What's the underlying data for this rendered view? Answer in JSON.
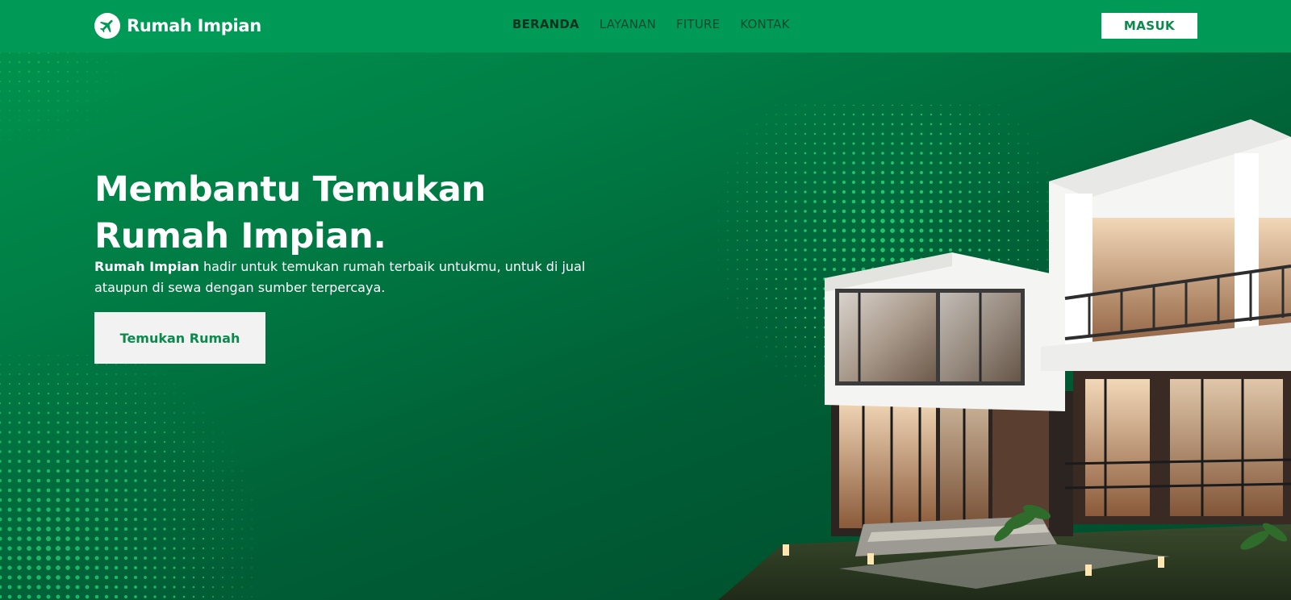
{
  "colors": {
    "brand_green": "#009a57",
    "hero_dark": "#004a2b",
    "cta_bg": "#f2f2f2",
    "cta_text": "#0a8a4d"
  },
  "header": {
    "brand_name": "Rumah Impian",
    "brand_icon": "plane-circle-icon",
    "nav": [
      {
        "label": "BERANDA",
        "active": true
      },
      {
        "label": "LAYANAN",
        "active": false
      },
      {
        "label": "FITURE",
        "active": false
      },
      {
        "label": "KONTAK",
        "active": false
      }
    ],
    "login_label": "MASUK"
  },
  "hero": {
    "title": "Membantu Temukan Rumah Impian.",
    "desc_bold": "Rumah Impian",
    "desc_rest": " hadir untuk temukan rumah terbaik untukmu, untuk di jual ataupun di sewa dengan sumber terpercaya.",
    "cta_label": "Temukan Rumah"
  }
}
